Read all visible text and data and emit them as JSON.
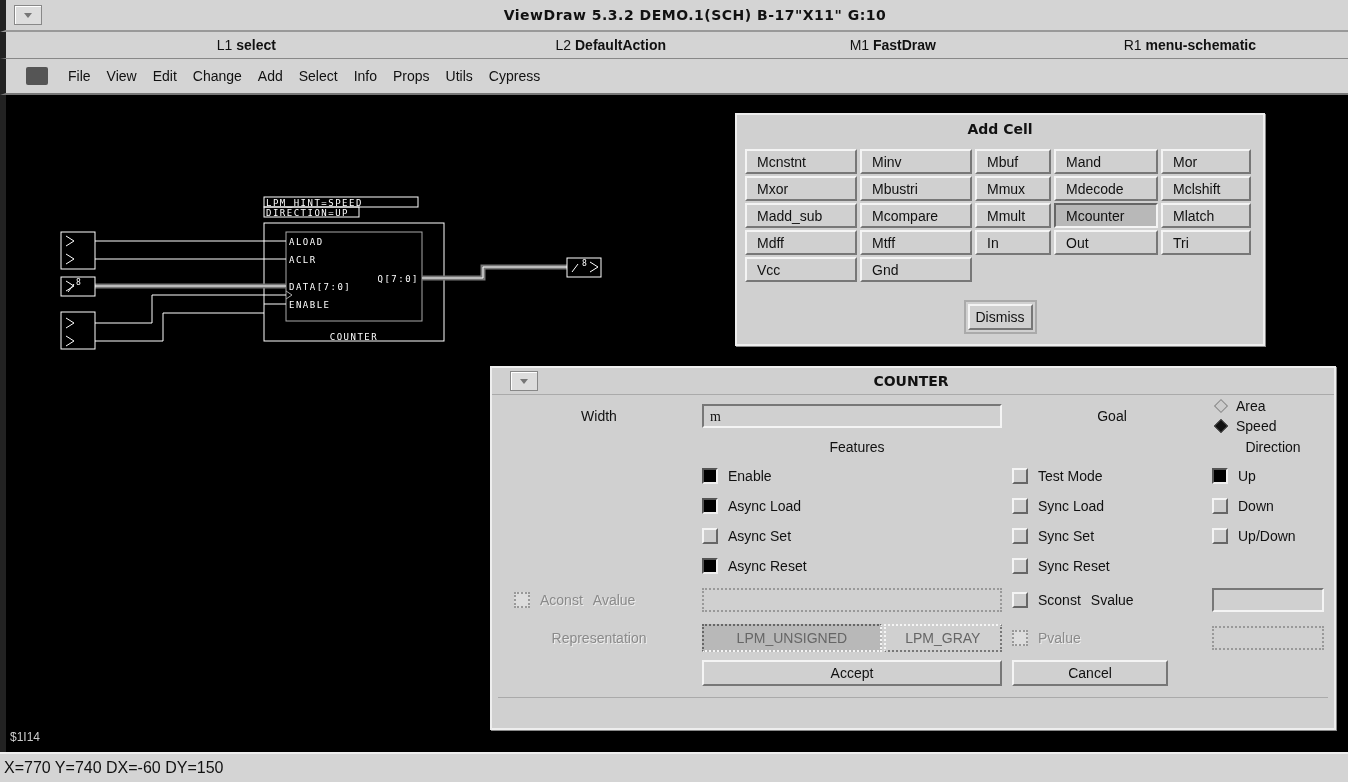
{
  "window": {
    "title": "ViewDraw 5.3.2 DEMO.1(SCH) B-17\"X11\" G:10"
  },
  "mouse_bar": [
    {
      "button": "L1",
      "action": "select"
    },
    {
      "button": "L2",
      "action": "DefaultAction"
    },
    {
      "button": "M1",
      "action": "FastDraw"
    },
    {
      "button": "R1",
      "action": "menu-schematic"
    }
  ],
  "menu": [
    "File",
    "View",
    "Edit",
    "Change",
    "Add",
    "Select",
    "Info",
    "Props",
    "Utils",
    "Cypress"
  ],
  "schematic": {
    "attributes": [
      "LPM_HINT=SPEED",
      "DIRECTION=UP"
    ],
    "inputs": [
      "ALOAD",
      "ACLR",
      "DATA[7:0]",
      "ENABLE"
    ],
    "output": "Q[7:0]",
    "cell": "COUNTER",
    "bus_width_in": "8",
    "bus_width_out": "8",
    "ref": "$1I14"
  },
  "add_cell": {
    "title": "Add Cell",
    "cells": [
      {
        "label": "Mcnstnt",
        "selected": false
      },
      {
        "label": "Minv",
        "selected": false
      },
      {
        "label": "Mbuf",
        "selected": false
      },
      {
        "label": "Mand",
        "selected": false
      },
      {
        "label": "Mor",
        "selected": false
      },
      {
        "label": "Mxor",
        "selected": false
      },
      {
        "label": "Mbustri",
        "selected": false
      },
      {
        "label": "Mmux",
        "selected": false
      },
      {
        "label": "Mdecode",
        "selected": false
      },
      {
        "label": "Mclshift",
        "selected": false
      },
      {
        "label": "Madd_sub",
        "selected": false
      },
      {
        "label": "Mcompare",
        "selected": false
      },
      {
        "label": "Mmult",
        "selected": false
      },
      {
        "label": "Mcounter",
        "selected": true
      },
      {
        "label": "Mlatch",
        "selected": false
      },
      {
        "label": "Mdff",
        "selected": false
      },
      {
        "label": "Mtff",
        "selected": false
      },
      {
        "label": "In",
        "selected": false
      },
      {
        "label": "Out",
        "selected": false
      },
      {
        "label": "Tri",
        "selected": false
      },
      {
        "label": "Vcc",
        "selected": false
      },
      {
        "label": "Gnd",
        "selected": false
      }
    ],
    "dismiss": "Dismiss"
  },
  "counter": {
    "title": "COUNTER",
    "width_label": "Width",
    "width_value": "m",
    "goal_label": "Goal",
    "goal": [
      {
        "label": "Area",
        "selected": false
      },
      {
        "label": "Speed",
        "selected": true
      }
    ],
    "features_label": "Features",
    "direction_label": "Direction",
    "features": [
      {
        "label": "Enable",
        "checked": true
      },
      {
        "label": "Async Load",
        "checked": true
      },
      {
        "label": "Async Set",
        "checked": false
      },
      {
        "label": "Async Reset",
        "checked": true
      }
    ],
    "sync_features": [
      {
        "label": "Test Mode",
        "checked": false
      },
      {
        "label": "Sync Load",
        "checked": false
      },
      {
        "label": "Sync Set",
        "checked": false
      },
      {
        "label": "Sync Reset",
        "checked": false
      }
    ],
    "direction": [
      {
        "label": "Up",
        "checked": true
      },
      {
        "label": "Down",
        "checked": false
      },
      {
        "label": "Up/Down",
        "checked": false
      }
    ],
    "aconst": {
      "label": "Aconst",
      "value_label": "Avalue",
      "checked": false,
      "disabled": true
    },
    "sconst": {
      "label": "Sconst",
      "value_label": "Svalue",
      "checked": false,
      "disabled": false
    },
    "representation_label": "Representation",
    "representation": [
      {
        "label": "LPM_UNSIGNED",
        "selected": true
      },
      {
        "label": "LPM_GRAY",
        "selected": false
      }
    ],
    "pvalue": {
      "label": "Pvalue",
      "checked": false,
      "disabled": true
    },
    "accept": "Accept",
    "cancel": "Cancel"
  },
  "status_bar": "X=770 Y=740 DX=-60 DY=150"
}
